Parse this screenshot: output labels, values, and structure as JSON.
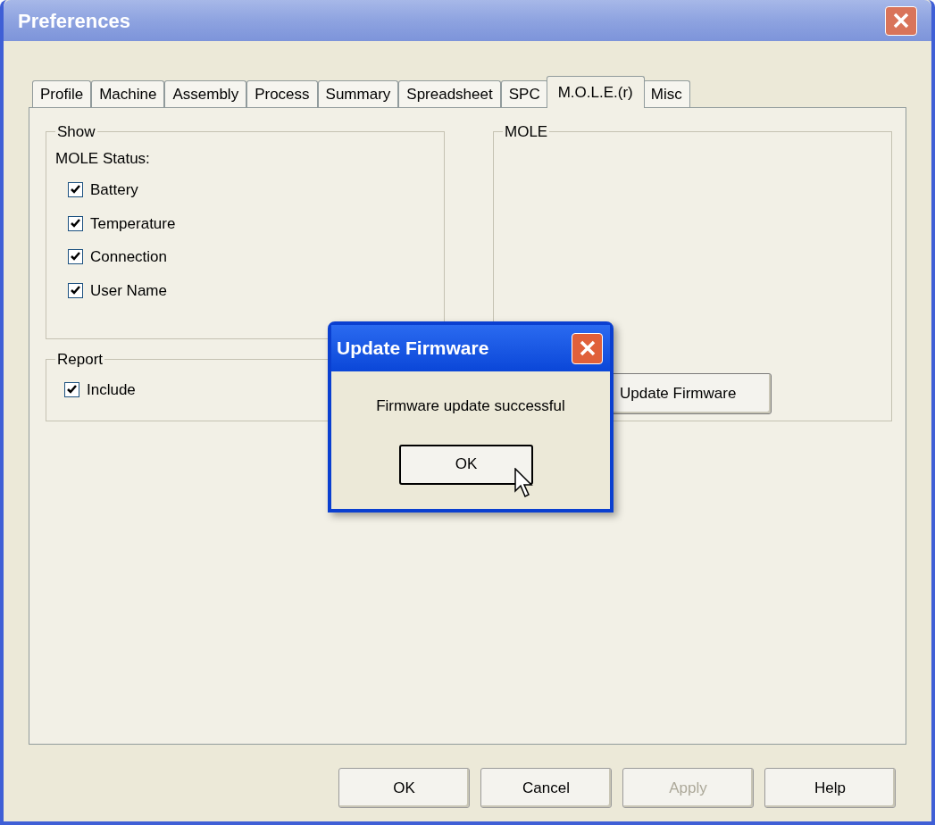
{
  "window": {
    "title": "Preferences"
  },
  "tabs": [
    {
      "label": "Profile",
      "selected": false
    },
    {
      "label": "Machine",
      "selected": false
    },
    {
      "label": "Assembly",
      "selected": false
    },
    {
      "label": "Process",
      "selected": false
    },
    {
      "label": "Summary",
      "selected": false
    },
    {
      "label": "Spreadsheet",
      "selected": false
    },
    {
      "label": "SPC",
      "selected": false
    },
    {
      "label": "M.O.L.E.(r)",
      "selected": true
    },
    {
      "label": "Misc",
      "selected": false
    }
  ],
  "show_group": {
    "title": "Show",
    "subtitle": "MOLE Status:",
    "checkboxes": [
      {
        "label": "Battery",
        "checked": true
      },
      {
        "label": "Temperature",
        "checked": true
      },
      {
        "label": "Connection",
        "checked": true
      },
      {
        "label": "User Name",
        "checked": true
      }
    ]
  },
  "report_group": {
    "title": "Report",
    "checkboxes": [
      {
        "label": "Include",
        "checked": true
      }
    ]
  },
  "mole_group": {
    "title": "MOLE",
    "button": "Update Firmware"
  },
  "buttons": [
    {
      "label": "OK",
      "disabled": false
    },
    {
      "label": "Cancel",
      "disabled": false
    },
    {
      "label": "Apply",
      "disabled": true
    },
    {
      "label": "Help",
      "disabled": false
    }
  ],
  "message_box": {
    "title": "Update Firmware",
    "message": "Firmware update successful",
    "button": "OK"
  }
}
